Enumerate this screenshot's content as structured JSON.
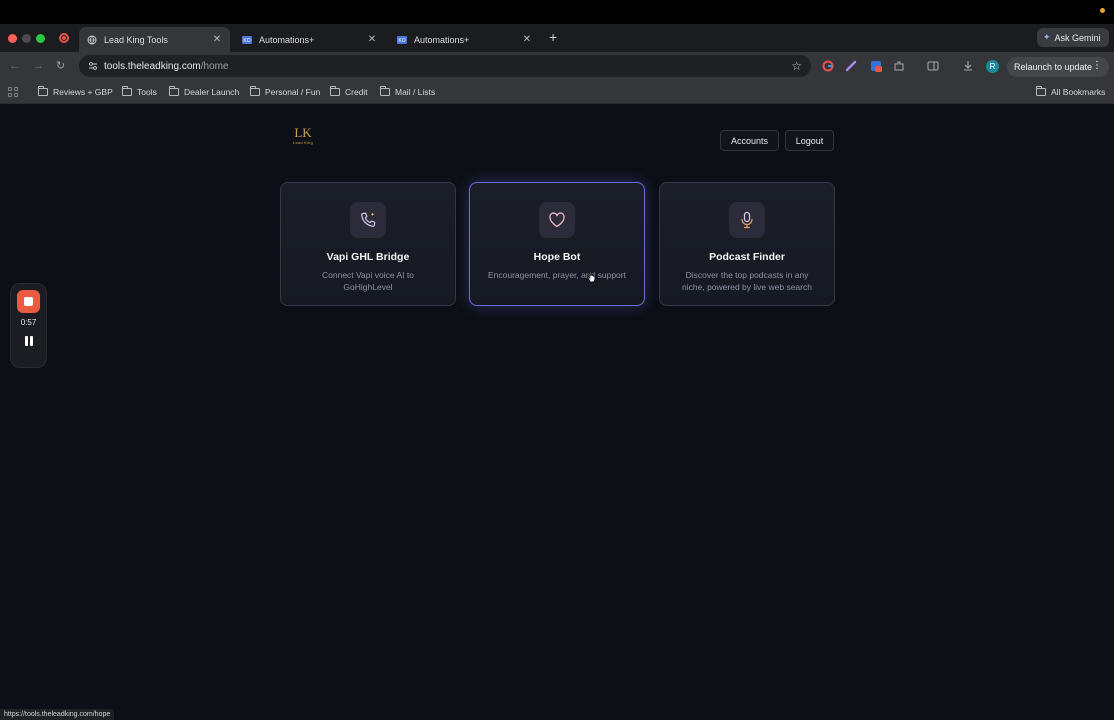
{
  "browser": {
    "tabs": [
      {
        "title": "Lead King Tools",
        "active": true
      },
      {
        "title": "Automations+",
        "active": false
      },
      {
        "title": "Automations+",
        "active": false
      }
    ],
    "ask_gemini": "Ask Gemini",
    "url_host": "tools.theleadking.com",
    "url_path": "/home",
    "relaunch": "Relaunch to update",
    "avatar_letter": "R",
    "bookmarks": [
      "Reviews + GBP",
      "Tools",
      "Dealer Launch",
      "Personal / Fun",
      "Credit",
      "Mail / Lists"
    ],
    "all_bookmarks": "All Bookmarks",
    "status_url": "https://tools.theleadking.com/hope"
  },
  "page": {
    "logo_mark": "LK",
    "logo_name": "Lead King",
    "accounts_label": "Accounts",
    "logout_label": "Logout",
    "cards": [
      {
        "title": "Vapi GHL Bridge",
        "description": "Connect Vapi voice AI to GoHighLevel",
        "icon": "phone-icon"
      },
      {
        "title": "Hope Bot",
        "description": "Encouragement, prayer, and support",
        "icon": "heart-icon"
      },
      {
        "title": "Podcast Finder",
        "description": "Discover the top podcasts in any niche, powered by live web search",
        "icon": "microphone-icon"
      }
    ]
  },
  "recorder": {
    "time": "0:57"
  },
  "colors": {
    "accent": "#6a6fd6",
    "icon_stroke": "#f2b8c6",
    "record": "#ea5b3f"
  }
}
